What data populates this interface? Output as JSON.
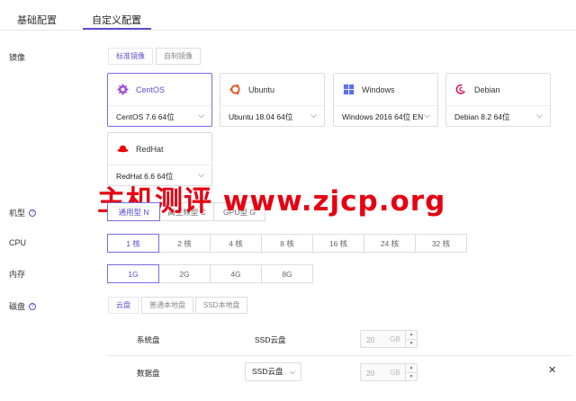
{
  "tabs": [
    {
      "label": "基础配置",
      "active": false
    },
    {
      "label": "自定义配置",
      "active": true
    }
  ],
  "image": {
    "label": "镜像",
    "subtabs": [
      {
        "label": "标准镜像",
        "active": true
      },
      {
        "label": "自制镜像",
        "active": false
      }
    ],
    "os": [
      {
        "name": "CentOS",
        "version": "CentOS 7.6 64位",
        "icon": "centos-icon",
        "color": "#a14fd1",
        "active": true
      },
      {
        "name": "Ubuntu",
        "version": "Ubuntu 18.04 64位",
        "icon": "ubuntu-icon",
        "color": "#e95420",
        "active": false
      },
      {
        "name": "Windows",
        "version": "Windows 2016 64位 EN",
        "icon": "windows-icon",
        "color": "#5a6ff0",
        "active": false
      },
      {
        "name": "Debian",
        "version": "Debian 8.2 64位",
        "icon": "debian-icon",
        "color": "#d70a53",
        "active": false
      },
      {
        "name": "RedHat",
        "version": "RedHat 6.6 64位",
        "icon": "redhat-icon",
        "color": "#e00",
        "active": false
      }
    ]
  },
  "machine": {
    "label": "机型",
    "options": [
      {
        "label": "通用型 N",
        "active": true
      },
      {
        "label": "高主频型 C",
        "active": false
      },
      {
        "label": "GPU型 G",
        "active": false
      }
    ]
  },
  "cpu": {
    "label": "CPU",
    "options": [
      {
        "label": "1 核",
        "active": true
      },
      {
        "label": "2 核",
        "active": false
      },
      {
        "label": "4 核",
        "active": false
      },
      {
        "label": "8 核",
        "active": false
      },
      {
        "label": "16 核",
        "active": false
      },
      {
        "label": "24 核",
        "active": false
      },
      {
        "label": "32 核",
        "active": false
      }
    ]
  },
  "memory": {
    "label": "内存",
    "options": [
      {
        "label": "1G",
        "active": true
      },
      {
        "label": "2G",
        "active": false
      },
      {
        "label": "4G",
        "active": false
      },
      {
        "label": "8G",
        "active": false
      }
    ]
  },
  "disk": {
    "label": "磁盘",
    "subtabs": [
      {
        "label": "云盘",
        "active": true
      },
      {
        "label": "普通本地盘",
        "active": false
      },
      {
        "label": "SSD本地盘",
        "active": false
      }
    ],
    "rows": [
      {
        "label": "系统盘",
        "type": "SSD云盘",
        "size": "20",
        "unit": "GB"
      },
      {
        "label": "数据盘",
        "type": "SSD云盘",
        "size": "20",
        "unit": "GB"
      }
    ]
  },
  "watermark": "主机测评 www.zjcp.org",
  "accent_color": "#5a4fcf"
}
